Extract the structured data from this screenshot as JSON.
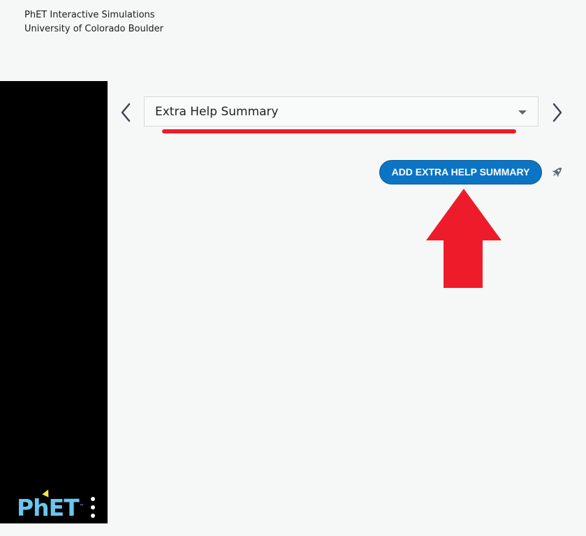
{
  "header": {
    "org_line1": "PhET Interactive Simulations",
    "org_line2": "University of Colorado Boulder"
  },
  "sim": {
    "logo_text": "PhET",
    "logo_tm": "™",
    "menu_icon": "kebab-menu-icon"
  },
  "navigation": {
    "prev_icon": "chevron-left-icon",
    "next_icon": "chevron-right-icon"
  },
  "selector": {
    "selected_value": "Extra Help Summary",
    "caret_icon": "caret-down-icon"
  },
  "actions": {
    "add_button_label": "ADD EXTRA HELP SUMMARY",
    "rocket_icon": "rocket-icon"
  },
  "annotations": {
    "underline_color": "#ee1c2b",
    "arrow_color": "#ee1c2b"
  },
  "colors": {
    "accent": "#0c74c4",
    "background": "#f6f8f8",
    "sim_background": "#000000",
    "logo": "#6bc5ee"
  }
}
